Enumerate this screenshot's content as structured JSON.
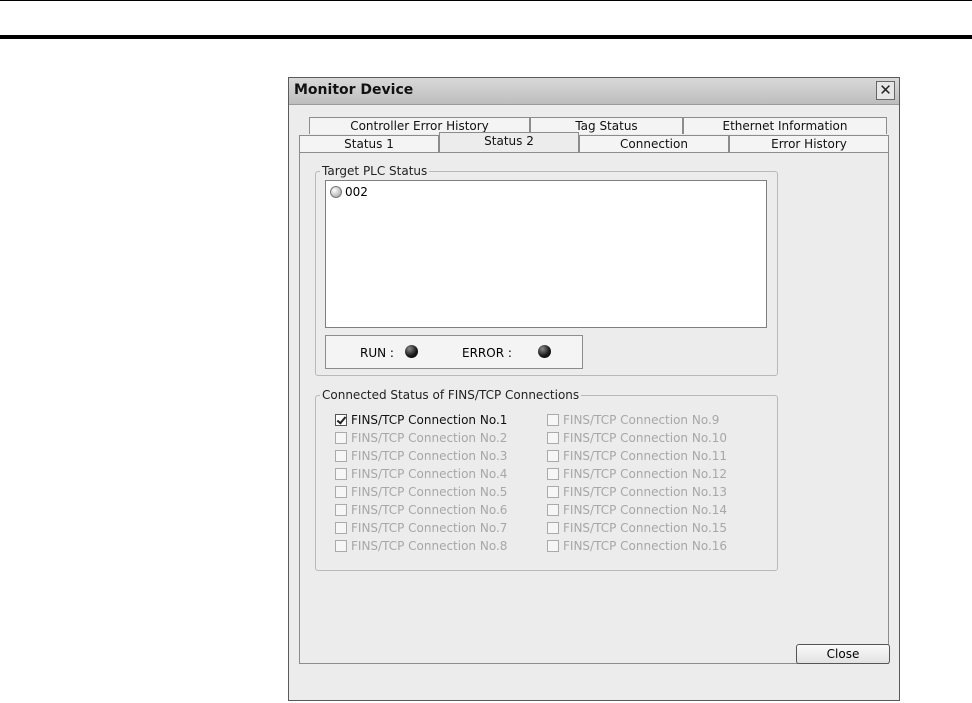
{
  "dialog": {
    "title": "Monitor Device",
    "close_glyph": "✕",
    "close_button_label": "Close"
  },
  "tabs": {
    "row_back": [
      "Controller Error History",
      "Tag Status",
      "Ethernet Information"
    ],
    "row_front": [
      "Status 1",
      "Status 2",
      "Connection",
      "Error History"
    ],
    "active": "Status 2"
  },
  "target_plc": {
    "group_label": "Target PLC Status",
    "items": [
      "002"
    ],
    "run_label": "RUN :",
    "error_label": "ERROR :"
  },
  "fins": {
    "group_label": "Connected Status of FINS/TCP Connections",
    "connections": [
      {
        "label": "FINS/TCP Connection No.1",
        "checked": true,
        "enabled": true
      },
      {
        "label": "FINS/TCP Connection No.2",
        "checked": false,
        "enabled": false
      },
      {
        "label": "FINS/TCP Connection No.3",
        "checked": false,
        "enabled": false
      },
      {
        "label": "FINS/TCP Connection No.4",
        "checked": false,
        "enabled": false
      },
      {
        "label": "FINS/TCP Connection No.5",
        "checked": false,
        "enabled": false
      },
      {
        "label": "FINS/TCP Connection No.6",
        "checked": false,
        "enabled": false
      },
      {
        "label": "FINS/TCP Connection No.7",
        "checked": false,
        "enabled": false
      },
      {
        "label": "FINS/TCP Connection No.8",
        "checked": false,
        "enabled": false
      },
      {
        "label": "FINS/TCP Connection No.9",
        "checked": false,
        "enabled": false
      },
      {
        "label": "FINS/TCP Connection No.10",
        "checked": false,
        "enabled": false
      },
      {
        "label": "FINS/TCP Connection No.11",
        "checked": false,
        "enabled": false
      },
      {
        "label": "FINS/TCP Connection No.12",
        "checked": false,
        "enabled": false
      },
      {
        "label": "FINS/TCP Connection No.13",
        "checked": false,
        "enabled": false
      },
      {
        "label": "FINS/TCP Connection No.14",
        "checked": false,
        "enabled": false
      },
      {
        "label": "FINS/TCP Connection No.15",
        "checked": false,
        "enabled": false
      },
      {
        "label": "FINS/TCP Connection No.16",
        "checked": false,
        "enabled": false
      }
    ]
  }
}
